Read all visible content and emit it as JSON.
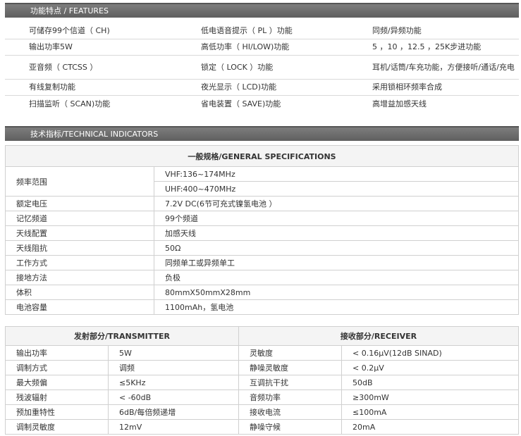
{
  "features": {
    "title": "功能特点 / FEATURES",
    "rows": [
      [
        "可储存99个信道（ CH)",
        "低电语音提示（ PL ）功能",
        "同频/异频功能"
      ],
      [
        "输出功率5W",
        "高低功率（ HI/LOW)功能",
        "5 ，10 ，12.5 ，25K步进功能"
      ],
      [
        "亚音频（ CTCSS ）",
        "锁定（ LOCK ）功能",
        "耳机/话筒/车充功能，方便接听/通话/充电"
      ],
      [
        "有线复制功能",
        "夜光显示（ LCD)功能",
        "采用锁相环频率合成"
      ],
      [
        "扫描监听（ SCAN)功能",
        "省电装置（ SAVE)功能",
        "高增益加感天线"
      ]
    ]
  },
  "technical": {
    "title": "技术指标/TECHNICAL INDICATORS"
  },
  "general": {
    "title": "一般规格/GENERAL SPECIFICATIONS",
    "freq_label": "频率范围",
    "freq_values": [
      "VHF:136~174MHz",
      "UHF:400~470MHz"
    ],
    "rows": [
      [
        "额定电压",
        "7.2V DC(6节可充式镍氢电池 ）"
      ],
      [
        "记忆频道",
        "99个频道"
      ],
      [
        "天线配置",
        "加感天线"
      ],
      [
        "天线阻抗",
        "50Ω"
      ],
      [
        "工作方式",
        "同频单工或异频单工"
      ],
      [
        "接地方法",
        "负极"
      ],
      [
        "体积",
        "80mmX50mmX28mm"
      ],
      [
        "电池容量",
        "1100mAh，氢电池"
      ]
    ]
  },
  "transceiver": {
    "tx_title": "发射部分/TRANSMITTER",
    "rx_title": "接收部分/RECEIVER",
    "rows": [
      [
        "输出功率",
        "5W",
        "灵敏度",
        "< 0.16μV(12dB SINAD)"
      ],
      [
        "调制方式",
        "调频",
        "静噪灵敏度",
        "< 0.2μV"
      ],
      [
        "最大频偏",
        "≤5KHz",
        "互调抗干扰",
        "50dB"
      ],
      [
        "残波辐射",
        "< -60dB",
        "音频功率",
        "≥300mW"
      ],
      [
        "预加重特性",
        "6dB/每倍频递增",
        "接收电流",
        "≤100mA"
      ],
      [
        "调制灵敏度",
        "12mV",
        "静噪守候",
        "20mA"
      ]
    ]
  }
}
